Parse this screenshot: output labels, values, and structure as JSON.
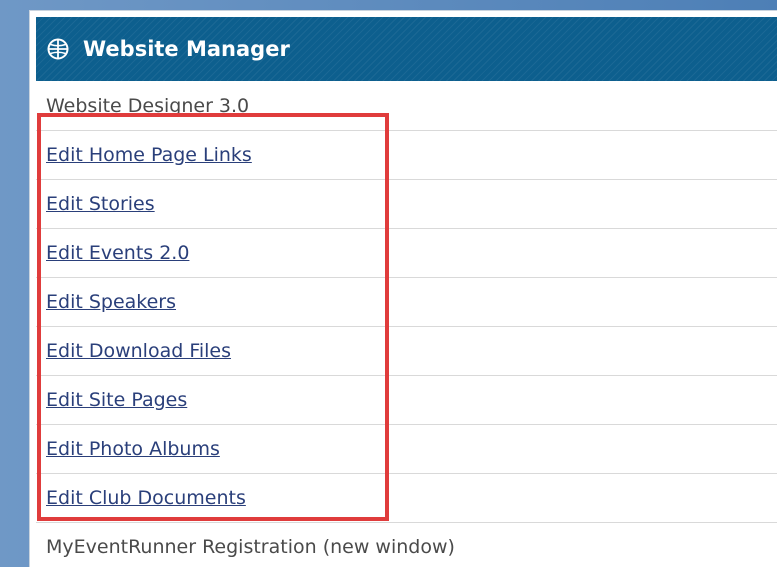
{
  "header": {
    "title": "Website Manager",
    "icon": "globe-icon",
    "background_color": "#0d5f8e"
  },
  "rows": [
    {
      "label": "Website Designer 3.0",
      "link": false
    },
    {
      "label": "Edit Home Page Links",
      "link": true
    },
    {
      "label": "Edit Stories",
      "link": true
    },
    {
      "label": "Edit Events 2.0",
      "link": true
    },
    {
      "label": "Edit Speakers",
      "link": true
    },
    {
      "label": "Edit Download Files",
      "link": true
    },
    {
      "label": "Edit Site Pages",
      "link": true
    },
    {
      "label": "Edit Photo Albums",
      "link": true
    },
    {
      "label": "Edit Club Documents",
      "link": true
    },
    {
      "label": "MyEventRunner Registration (new window)",
      "link": false
    }
  ],
  "highlight_color": "#e03c3c"
}
